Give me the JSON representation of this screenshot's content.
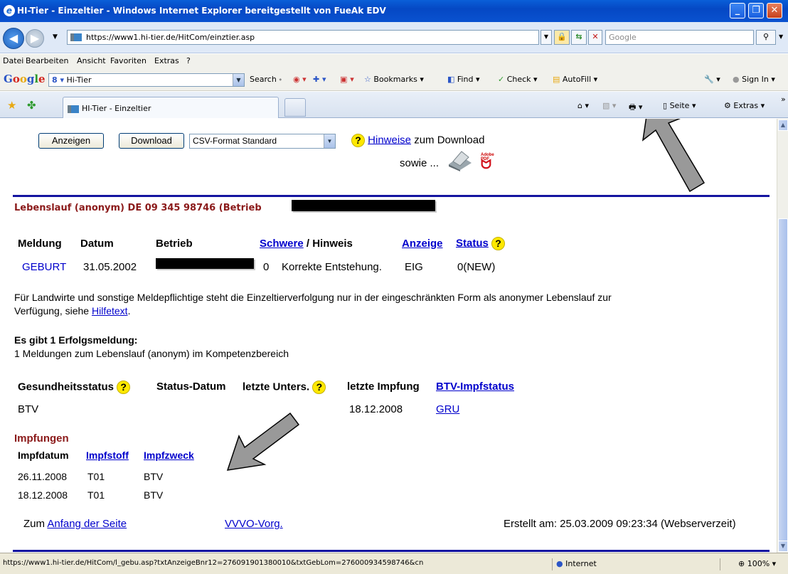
{
  "window": {
    "title": "HI-Tier - Einzeltier - Windows Internet Explorer bereitgestellt von FueAk EDV",
    "url": "https://www1.hi-tier.de/HitCom/einztier.asp",
    "search_placeholder": "Google"
  },
  "menu": [
    "Datei",
    "Bearbeiten",
    "Ansicht",
    "Favoriten",
    "Extras",
    "?"
  ],
  "google_toolbar": {
    "logo": [
      "G",
      "o",
      "o",
      "g",
      "l",
      "e"
    ],
    "query": "Hi-Tier",
    "items": [
      "Search",
      "Bookmarks",
      "Find",
      "Check",
      "AutoFill",
      "Sign In"
    ]
  },
  "tab": {
    "label": "HI-Tier - Einzeltier",
    "right_items": [
      "Seite",
      "Extras"
    ]
  },
  "page": {
    "buttons": {
      "show": "Anzeigen",
      "download": "Download"
    },
    "format_select": "CSV-Format Standard",
    "hint_link": "Hinweise",
    "hint_text": "zum Download",
    "sowie": "sowie ...",
    "pdf_label": "Adobe PDF",
    "lebenslauf_heading": "Lebenslauf (anonym) DE 09 345 98746 (Betrieb",
    "table1": {
      "headers": {
        "meldung": "Meldung",
        "datum": "Datum",
        "betrieb": "Betrieb",
        "schwere": "Schwere",
        "hinweis": "/ Hinweis",
        "anzeige": "Anzeige",
        "status": "Status"
      },
      "row": {
        "meldung": "GEBURT",
        "datum": "31.05.2002",
        "schwere": "0",
        "hinweis": "Korrekte Entstehung.",
        "anzeige": "EIG",
        "status": "0(NEW)"
      }
    },
    "info_text_line1": "Für Landwirte und sonstige Meldepflichtige steht die Einzeltierverfolgung nur in der eingeschränkten Form  als anonymer Lebenslauf zur",
    "info_text_line2": "Verfügung, siehe",
    "info_link": "Hilfetext",
    "info_end": ".",
    "success_heading": "Es gibt 1 Erfolgsmeldung:",
    "success_text": "1 Meldungen zum Lebenslauf (anonym) im Kompetenzbereich",
    "health": {
      "headers": {
        "status": "Gesundheitsstatus",
        "status_datum": "Status-Datum",
        "letzte_unters": "letzte Unters.",
        "letzte_impfung": "letzte Impfung",
        "btv_impfstatus": "BTV-Impfstatus"
      },
      "row": {
        "status": "BTV",
        "letzte_impfung": "18.12.2008",
        "btv_impfstatus": "GRU"
      }
    },
    "impfungen": {
      "heading": "Impfungen",
      "headers": {
        "impfdatum": "Impfdatum",
        "impfstoff": "Impfstoff",
        "impfzweck": "Impfzweck"
      },
      "rows": [
        {
          "impfdatum": "26.11.2008",
          "impfstoff": "T01",
          "impfzweck": "BTV"
        },
        {
          "impfdatum": "18.12.2008",
          "impfstoff": "T01",
          "impfzweck": "BTV"
        }
      ]
    },
    "footer": {
      "prefix": "Zum",
      "top_link": "Anfang der Seite",
      "vvvo_link": "VVVO-Vorg.",
      "created": "Erstellt am: 25.03.2009 09:23:34 (Webserverzeit)"
    }
  },
  "statusbar": {
    "url": "https://www1.hi-tier.de/HitCom/l_gebu.asp?txtAnzeigeBnr12=276091901380010&txtGebLom=276000934598746&cn",
    "zone": "Internet",
    "zoom": "100%"
  }
}
